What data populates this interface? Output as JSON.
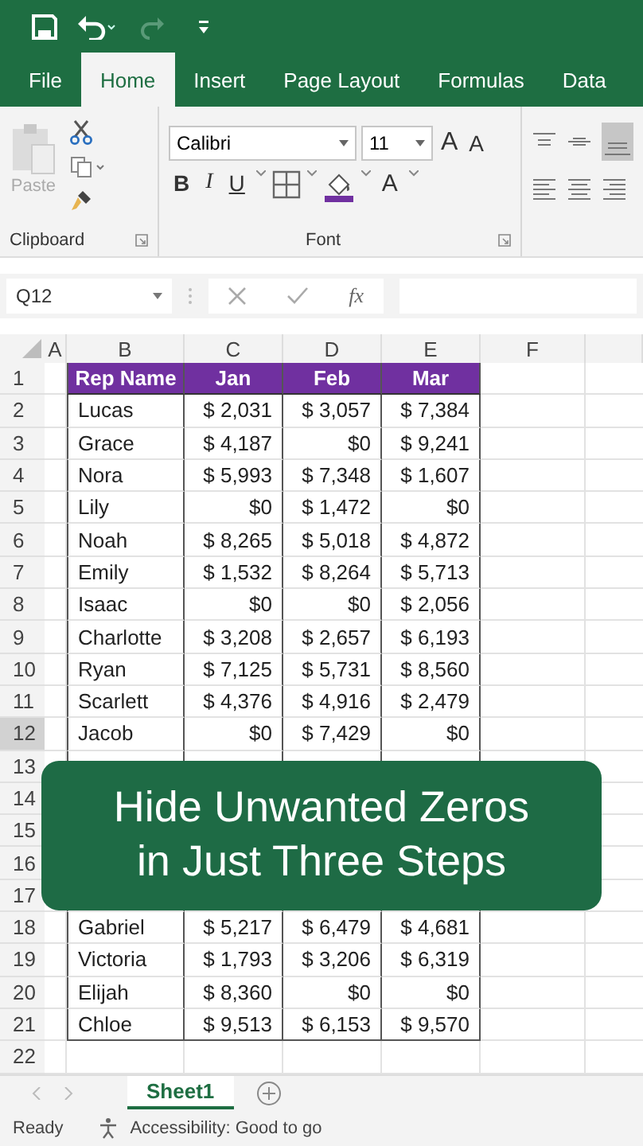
{
  "tabs": [
    {
      "label": "File",
      "selected": false
    },
    {
      "label": "Home",
      "selected": true
    },
    {
      "label": "Insert",
      "selected": false
    },
    {
      "label": "Page Layout",
      "selected": false
    },
    {
      "label": "Formulas",
      "selected": false
    },
    {
      "label": "Data",
      "selected": false
    }
  ],
  "clipboard": {
    "paste": "Paste",
    "paste_disabled": true,
    "group_label": "Clipboard"
  },
  "font": {
    "name": "Calibri",
    "size": "11",
    "grow": "A",
    "shrink": "A",
    "bold": "B",
    "italic": "I",
    "underline": "U",
    "font_color": "A",
    "group_label": "Font"
  },
  "name_box": "Q12",
  "fx": "fx",
  "columns": [
    "A",
    "B",
    "C",
    "D",
    "E",
    "F"
  ],
  "rows": [
    {
      "number": "1",
      "selected": false,
      "header": true,
      "cells": [
        "Rep Name",
        "Jan",
        "Feb",
        "Mar"
      ]
    },
    {
      "number": "2",
      "selected": false,
      "cells": [
        "Lucas",
        "$ 2,031",
        "$ 3,057",
        "$ 7,384"
      ]
    },
    {
      "number": "3",
      "selected": false,
      "cells": [
        "Grace",
        "$ 4,187",
        "$0",
        "$ 9,241"
      ]
    },
    {
      "number": "4",
      "selected": false,
      "cells": [
        "Nora",
        "$ 5,993",
        "$ 7,348",
        "$ 1,607"
      ]
    },
    {
      "number": "5",
      "selected": false,
      "cells": [
        "Lily",
        "$0",
        "$ 1,472",
        "$0"
      ]
    },
    {
      "number": "6",
      "selected": false,
      "cells": [
        "Noah",
        "$ 8,265",
        "$ 5,018",
        "$ 4,872"
      ]
    },
    {
      "number": "7",
      "selected": false,
      "cells": [
        "Emily",
        "$ 1,532",
        "$ 8,264",
        "$ 5,713"
      ]
    },
    {
      "number": "8",
      "selected": false,
      "cells": [
        "Isaac",
        "$0",
        "$0",
        "$ 2,056"
      ]
    },
    {
      "number": "9",
      "selected": false,
      "cells": [
        "Charlotte",
        "$ 3,208",
        "$ 2,657",
        "$ 6,193"
      ]
    },
    {
      "number": "10",
      "selected": false,
      "cells": [
        "Ryan",
        "$ 7,125",
        "$ 5,731",
        "$ 8,560"
      ]
    },
    {
      "number": "11",
      "selected": false,
      "cells": [
        "Scarlett",
        "$ 4,376",
        "$ 4,916",
        "$ 2,479"
      ]
    },
    {
      "number": "12",
      "selected": true,
      "cells": [
        "Jacob",
        "$0",
        "$ 7,429",
        "$0"
      ]
    },
    {
      "number": "13",
      "selected": false
    },
    {
      "number": "14",
      "selected": false
    },
    {
      "number": "15",
      "selected": false
    },
    {
      "number": "16",
      "selected": false
    },
    {
      "number": "17",
      "selected": false
    },
    {
      "number": "18",
      "selected": false,
      "cells": [
        "Gabriel",
        "$ 5,217",
        "$ 6,479",
        "$ 4,681"
      ]
    },
    {
      "number": "19",
      "selected": false,
      "cells": [
        "Victoria",
        "$ 1,793",
        "$ 3,206",
        "$ 6,319"
      ]
    },
    {
      "number": "20",
      "selected": false,
      "cells": [
        "Elijah",
        "$ 8,360",
        "$0",
        "$0"
      ]
    },
    {
      "number": "21",
      "selected": false,
      "cells": [
        "Chloe",
        "$ 9,513",
        "$ 6,153",
        "$ 9,570"
      ]
    },
    {
      "number": "22",
      "selected": false
    }
  ],
  "banner": [
    "Hide Unwanted Zeros",
    "in Just Three Steps"
  ],
  "sheet_tabs": [
    {
      "label": "Sheet1",
      "selected": true
    }
  ],
  "status": {
    "mode": "Ready",
    "accessibility": "Accessibility: Good to go"
  }
}
